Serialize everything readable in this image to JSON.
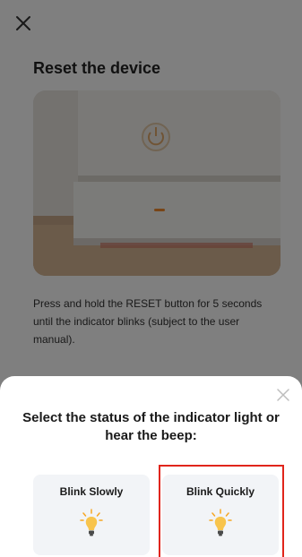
{
  "page": {
    "title": "Reset the device",
    "instructions": "Press and hold the RESET button for 5 seconds until the indicator blinks (subject to the user manual).",
    "close_icon": "close-icon",
    "photo": "device-photo"
  },
  "sheet": {
    "title": "Select the status of the indicator light or hear the beep:",
    "close_icon": "close-icon",
    "options": [
      {
        "label": "Blink Slowly",
        "icon": "bulb-icon"
      },
      {
        "label": "Blink Quickly",
        "icon": "bulb-icon"
      }
    ]
  },
  "colors": {
    "accent_orange": "#f6a623",
    "highlight_red": "#e0251b",
    "option_bg": "#f2f4f7"
  }
}
